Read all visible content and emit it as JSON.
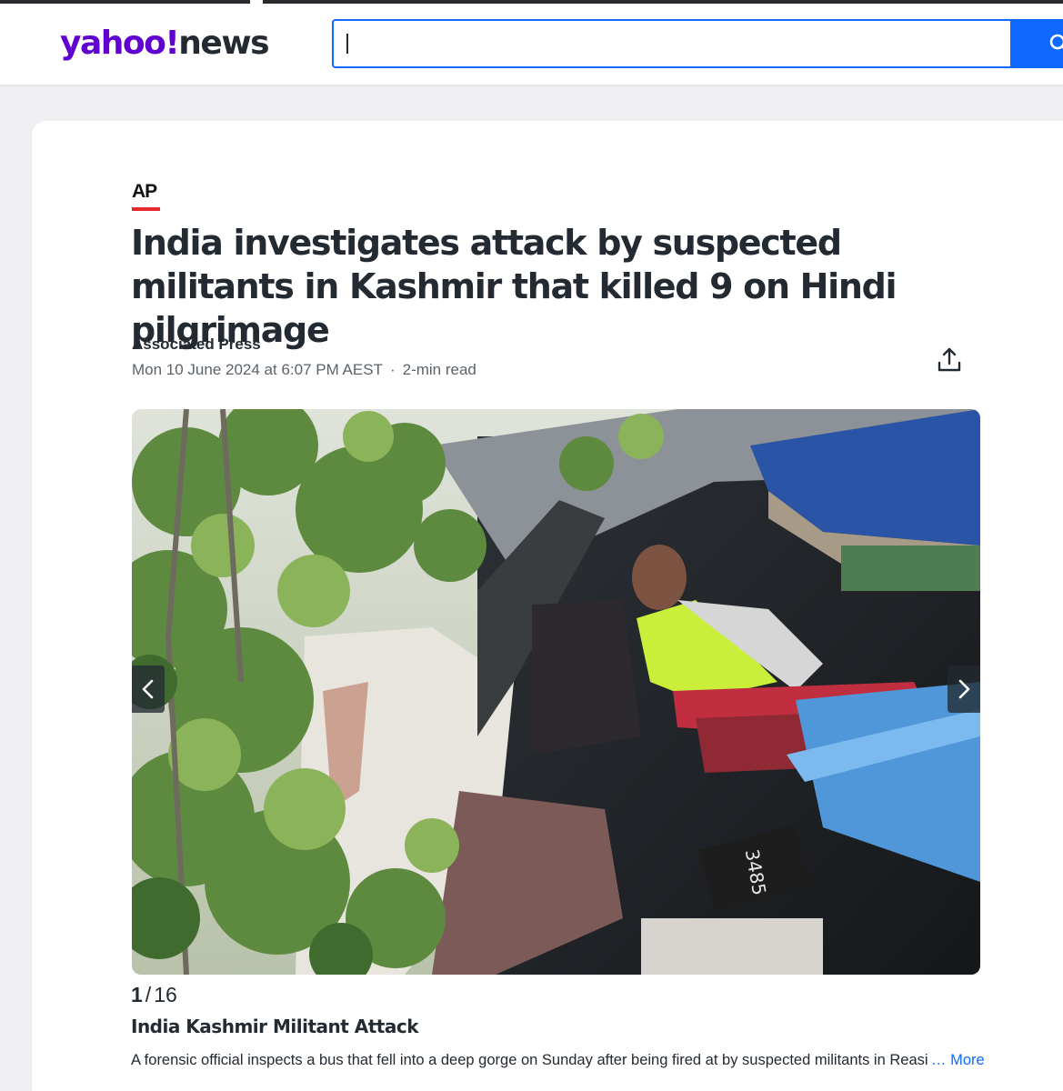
{
  "header": {
    "logo_yahoo": "yahoo!",
    "logo_news": "news",
    "search_value": ""
  },
  "article": {
    "provider": "AP",
    "title": "India investigates attack by suspected militants in Kashmir that killed 9 on Hindi pilgrimage",
    "author": "Associated Press",
    "date": "Mon 10 June 2024 at 6:07 PM AEST",
    "read_time": "2-min read"
  },
  "slideshow": {
    "current": "1",
    "total": "16",
    "caption_title": "India Kashmir Militant Attack",
    "caption": "A forensic official inspects a bus that fell into a deep gorge on Sunday after being fired at by suspected militants in Reasi",
    "more_label": "… More",
    "bus_number_text": "3485"
  },
  "colors": {
    "brand_purple": "#6001d2",
    "search_blue": "#0f69ff",
    "ap_red": "#e6292a"
  },
  "icons": [
    "search-icon",
    "share-icon",
    "chevron-left-icon",
    "chevron-right-icon"
  ]
}
